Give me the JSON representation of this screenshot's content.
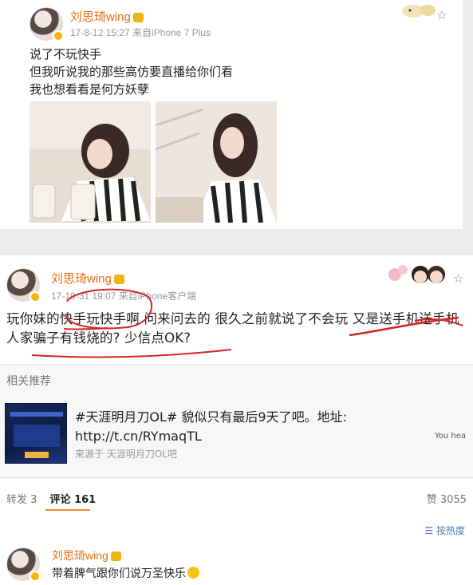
{
  "post1": {
    "username": "刘思琦wing",
    "meta": "17-8-12 15:27  来自iPhone 7 Plus",
    "lines": [
      "说了不玩快手",
      "但我听说我的那些高仿要直播给你们看",
      "我也想看看是何方妖孽"
    ]
  },
  "post2": {
    "username": "刘思琦wing",
    "meta": "17-10-31 19:07  来自iPhone客户端",
    "text": "玩你妹的快手玩快手啊 问来问去的 很久之前就说了不会玩 又是送手机送手机 人家骗子有钱烧的? 少信点OK?"
  },
  "related": {
    "label": "相关推荐",
    "ad_text": "#天涯明月刀OL# 貌似只有最后9天了吧。地址: http://t.cn/RYmaqTL",
    "ad_source": "来源于 天涯明月刀OL吧",
    "ad_side": "You hea"
  },
  "tabs": {
    "repost": "转发 3",
    "comment": "评论 161",
    "likes": "赞 3055"
  },
  "sort": {
    "label": "按热度"
  },
  "comment": {
    "username": "刘思琦wing",
    "text": "带着脾气跟你们说万圣快乐"
  },
  "colors": {
    "username": "#e8700f",
    "accent": "#f08a2a",
    "link": "#4a7bb6",
    "mark": "#d42424"
  },
  "icons": [
    "star-icon",
    "verified-badge-icon",
    "crown-icon",
    "sort-icon",
    "smile-emoji-icon"
  ]
}
